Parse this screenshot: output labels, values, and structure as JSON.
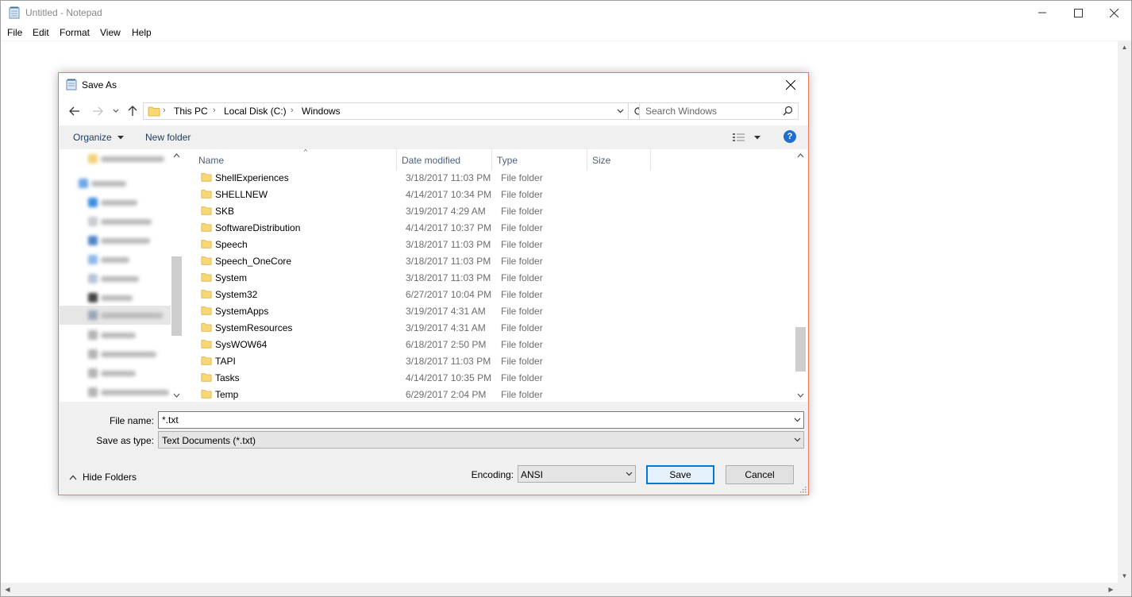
{
  "notepad": {
    "title": "Untitled - Notepad",
    "menu": [
      "File",
      "Edit",
      "Format",
      "View",
      "Help"
    ]
  },
  "dialog": {
    "title": "Save As",
    "breadcrumbs": [
      "This PC",
      "Local Disk (C:)",
      "Windows"
    ],
    "search_placeholder": "Search Windows",
    "organize_label": "Organize",
    "new_folder_label": "New folder",
    "help_label": "?",
    "columns": {
      "name": "Name",
      "date": "Date modified",
      "type": "Type",
      "size": "Size"
    },
    "files": [
      {
        "name": "ShellExperiences",
        "date": "3/18/2017 11:03 PM",
        "type": "File folder"
      },
      {
        "name": "SHELLNEW",
        "date": "4/14/2017 10:34 PM",
        "type": "File folder"
      },
      {
        "name": "SKB",
        "date": "3/19/2017 4:29 AM",
        "type": "File folder"
      },
      {
        "name": "SoftwareDistribution",
        "date": "4/14/2017 10:37 PM",
        "type": "File folder"
      },
      {
        "name": "Speech",
        "date": "3/18/2017 11:03 PM",
        "type": "File folder"
      },
      {
        "name": "Speech_OneCore",
        "date": "3/18/2017 11:03 PM",
        "type": "File folder"
      },
      {
        "name": "System",
        "date": "3/18/2017 11:03 PM",
        "type": "File folder"
      },
      {
        "name": "System32",
        "date": "6/27/2017 10:04 PM",
        "type": "File folder"
      },
      {
        "name": "SystemApps",
        "date": "3/19/2017 4:31 AM",
        "type": "File folder"
      },
      {
        "name": "SystemResources",
        "date": "3/19/2017 4:31 AM",
        "type": "File folder"
      },
      {
        "name": "SysWOW64",
        "date": "6/18/2017 2:50 PM",
        "type": "File folder"
      },
      {
        "name": "TAPI",
        "date": "3/18/2017 11:03 PM",
        "type": "File folder"
      },
      {
        "name": "Tasks",
        "date": "4/14/2017 10:35 PM",
        "type": "File folder"
      },
      {
        "name": "Temp",
        "date": "6/29/2017 2:04 PM",
        "type": "File folder"
      }
    ],
    "file_name_label": "File name:",
    "file_name_value": "*.txt",
    "save_type_label": "Save as type:",
    "save_type_value": "Text Documents (*.txt)",
    "hide_folders_label": "Hide Folders",
    "encoding_label": "Encoding:",
    "encoding_value": "ANSI",
    "save_button": "Save",
    "cancel_button": "Cancel"
  },
  "colors": {
    "dialog_border": "#e37f60",
    "folder_yellow": "#f8d775",
    "accent": "#0078d7",
    "help_blue": "#1e6fd0"
  }
}
